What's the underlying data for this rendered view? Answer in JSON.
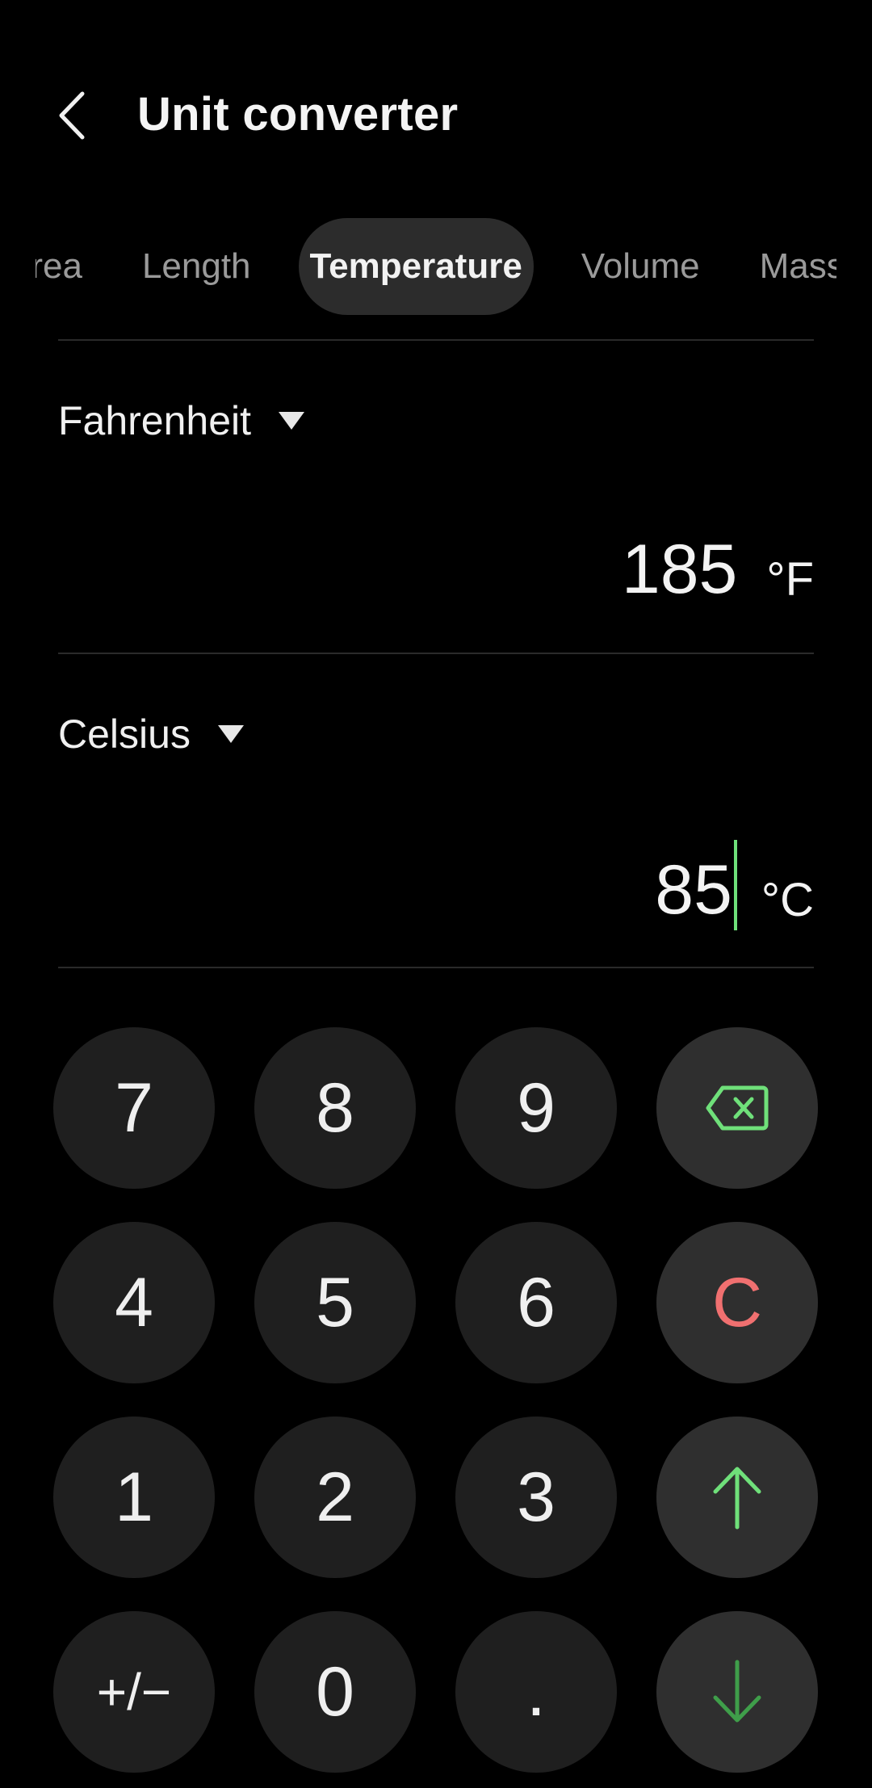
{
  "header": {
    "title": "Unit converter"
  },
  "tabs": [
    {
      "label": "Area",
      "active": false
    },
    {
      "label": "Length",
      "active": false
    },
    {
      "label": "Temperature",
      "active": true
    },
    {
      "label": "Volume",
      "active": false
    },
    {
      "label": "Mass",
      "active": false
    }
  ],
  "from": {
    "unit": "Fahrenheit",
    "value": "185",
    "symbol": "°F"
  },
  "to": {
    "unit": "Celsius",
    "value": "85",
    "symbol": "°C"
  },
  "keypad": {
    "keys": [
      "7",
      "8",
      "9",
      "4",
      "5",
      "6",
      "1",
      "2",
      "3",
      "+/−",
      "0",
      "."
    ],
    "clear_label": "C",
    "backspace_icon": "backspace-icon",
    "up_icon": "arrow-up-icon",
    "down_icon": "arrow-down-icon"
  },
  "colors": {
    "background": "#000000",
    "accent_green": "#6fe07a",
    "clear_red": "#f07070",
    "key_bg": "#1f1f1f",
    "fn_key_bg": "#2f2f2f"
  }
}
